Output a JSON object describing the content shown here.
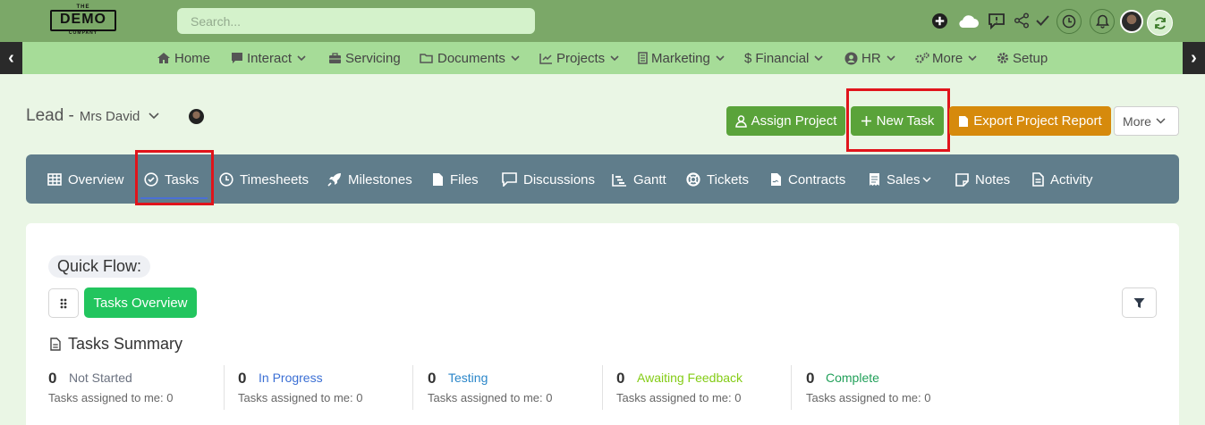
{
  "logo": {
    "tag": "THE",
    "name": "DEMO",
    "sub": "COMPANY"
  },
  "search": {
    "placeholder": "Search..."
  },
  "topbar_icons": [
    "plus-circle-icon",
    "cloud-icon",
    "chat-icon",
    "share-icon",
    "check-icon",
    "clock-icon",
    "bell-icon",
    "avatar",
    "refresh-icon"
  ],
  "nav": {
    "items": [
      {
        "label": "Home",
        "icon": "home-icon"
      },
      {
        "label": "Interact",
        "icon": "chat-icon",
        "dropdown": true
      },
      {
        "label": "Servicing",
        "icon": "briefcase-icon"
      },
      {
        "label": "Documents",
        "icon": "folder-icon",
        "dropdown": true
      },
      {
        "label": "Projects",
        "icon": "chart-icon",
        "dropdown": true
      },
      {
        "label": "Marketing",
        "icon": "list-icon",
        "dropdown": true
      },
      {
        "label": "Financial",
        "icon": "dollar-icon",
        "dropdown": true
      },
      {
        "label": "HR",
        "icon": "user-circle-icon",
        "dropdown": true
      },
      {
        "label": "More",
        "icon": "cogs-icon",
        "dropdown": true
      },
      {
        "label": "Setup",
        "icon": "gear-icon"
      }
    ]
  },
  "header": {
    "lead_prefix": "Lead -",
    "lead_name": "Mrs David"
  },
  "actions": {
    "assign_project": "Assign Project",
    "new_task": "New Task",
    "export_report": "Export Project Report",
    "more": "More"
  },
  "tabs": [
    {
      "label": "Overview",
      "icon": "table-icon"
    },
    {
      "label": "Tasks",
      "icon": "check-circle-icon",
      "active": true
    },
    {
      "label": "Timesheets",
      "icon": "clock-icon"
    },
    {
      "label": "Milestones",
      "icon": "rocket-icon"
    },
    {
      "label": "Files",
      "icon": "file-icon"
    },
    {
      "label": "Discussions",
      "icon": "comment-icon"
    },
    {
      "label": "Gantt",
      "icon": "gantt-icon"
    },
    {
      "label": "Tickets",
      "icon": "lifebuoy-icon"
    },
    {
      "label": "Contracts",
      "icon": "contract-icon"
    },
    {
      "label": "Sales",
      "icon": "receipt-icon",
      "dropdown": true
    },
    {
      "label": "Notes",
      "icon": "note-icon"
    },
    {
      "label": "Activity",
      "icon": "activity-icon"
    }
  ],
  "quick_flow": {
    "label": "Quick Flow:",
    "tasks_overview": "Tasks Overview"
  },
  "summary": {
    "title": "Tasks Summary",
    "stats": [
      {
        "count": "0",
        "status": "Not Started",
        "color": "#6b7280",
        "sub": "Tasks assigned to me: 0"
      },
      {
        "count": "0",
        "status": "In Progress",
        "color": "#3b6fd4",
        "sub": "Tasks assigned to me: 0"
      },
      {
        "count": "0",
        "status": "Testing",
        "color": "#2a86c9",
        "sub": "Tasks assigned to me: 0"
      },
      {
        "count": "0",
        "status": "Awaiting Feedback",
        "color": "#84cc16",
        "sub": "Tasks assigned to me: 0"
      },
      {
        "count": "0",
        "status": "Complete",
        "color": "#22a05a",
        "sub": "Tasks assigned to me: 0"
      }
    ]
  },
  "colors": {
    "topbar": "#7ba868",
    "navbar": "#a6dc98",
    "tabsbar": "#607d8b",
    "green": "#5aa33a",
    "orange": "#d68a0c",
    "highlight": "#e0141b"
  }
}
